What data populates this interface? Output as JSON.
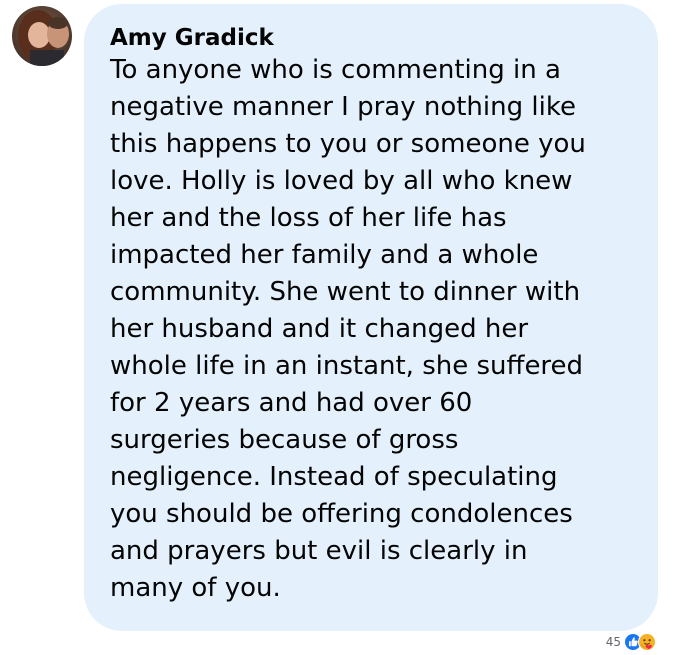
{
  "comment": {
    "author": "Amy Gradick",
    "lines": [
      "To anyone who is commenting in a",
      "negative manner I pray nothing like",
      "this happens to you or someone you",
      "love. Holly is loved by all who knew",
      "her and the loss of her life has",
      "impacted her family and a whole",
      "community. She went to dinner with",
      "her husband and it changed her",
      "whole life in an instant, she suffered",
      "for 2 years and had over 60",
      "surgeries because of gross",
      "negligence. Instead of speculating",
      "you should be offering condolences",
      "and prayers but evil is clearly in",
      "many of you."
    ],
    "bubble_color": "#e4f0fb",
    "text_color": "#050505"
  },
  "reactions": {
    "count": "45",
    "icons": [
      "like-icon",
      "care-icon"
    ],
    "like_color": "#1877f2"
  }
}
